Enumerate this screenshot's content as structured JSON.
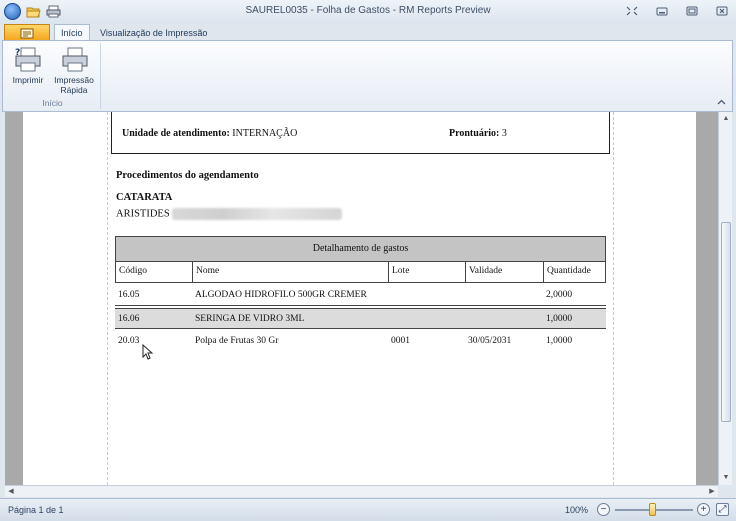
{
  "window": {
    "title": "SAUREL0035 - Folha de Gastos - RM Reports Preview"
  },
  "tabs": [
    {
      "label": "Início"
    },
    {
      "label": "Visualização de Impressão"
    }
  ],
  "ribbon": {
    "print_label": "Imprimir",
    "quick_print_label_1": "Impressão",
    "quick_print_label_2": "Rápida",
    "group_label": "Início"
  },
  "report": {
    "unidade_label": "Unidade de atendimento:",
    "unidade_value": "INTERNAÇÃO",
    "prontuario_label": "Prontuário:",
    "prontuario_value": "3",
    "procedimentos_title": "Procedimentos do agendamento",
    "procedure_name": "CATARATA",
    "patient_name": "ARISTIDES",
    "table_title": "Detalhamento de gastos",
    "columns": [
      "Código",
      "Nome",
      "Lote",
      "Validade",
      "Quantidade"
    ],
    "rows": [
      {
        "codigo": "16.05",
        "nome": "ALGODAO HIDROFILO 500GR CREMER",
        "lote": "",
        "validade": "",
        "quantidade": "2,0000"
      },
      {
        "codigo": "16.06",
        "nome": "SERINGA DE VIDRO 3ML",
        "lote": "",
        "validade": "",
        "quantidade": "1,0000"
      },
      {
        "codigo": "20.03",
        "nome": "Polpa de Frutas 30 Gr",
        "lote": "0001",
        "validade": "30/05/2031",
        "quantidade": "1,0000"
      }
    ]
  },
  "status": {
    "page_text": "Página 1 de 1",
    "zoom_text": "100%",
    "zoom_level_fraction": 0.45
  }
}
